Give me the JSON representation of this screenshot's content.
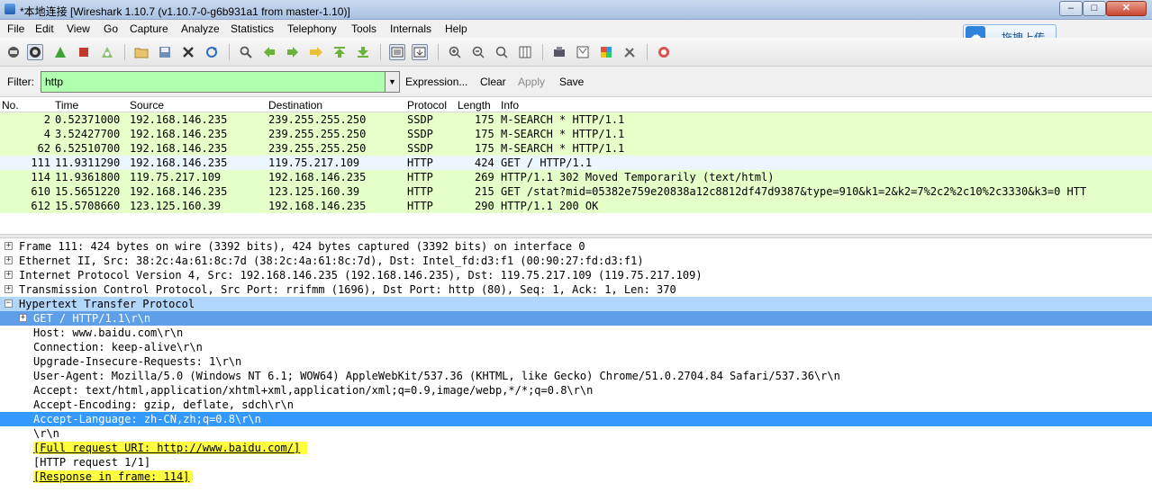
{
  "window": {
    "title": "*本地连接  [Wireshark 1.10.7  (v1.10.7-0-g6b931a1 from master-1.10)]",
    "buttons": {
      "minimize": "–",
      "maximize": "□",
      "close": "✕"
    }
  },
  "menu": [
    "File",
    "Edit",
    "View",
    "Go",
    "Capture",
    "Analyze",
    "Statistics",
    "Telephony",
    "Tools",
    "Internals",
    "Help"
  ],
  "cloud_upload": {
    "label": "拖拽上传"
  },
  "filter": {
    "label": "Filter:",
    "value": "http",
    "actions": {
      "expression": "Expression...",
      "clear": "Clear",
      "apply": "Apply",
      "save": "Save"
    }
  },
  "packet_list": {
    "columns": {
      "no": "No.",
      "time": "Time",
      "source": "Source",
      "destination": "Destination",
      "protocol": "Protocol",
      "length": "Length",
      "info": "Info"
    },
    "rows": [
      {
        "no": "2",
        "time": "0.52371000",
        "source": "192.168.146.235",
        "destination": "239.255.255.250",
        "protocol": "SSDP",
        "length": "175",
        "info": "M-SEARCH * HTTP/1.1"
      },
      {
        "no": "4",
        "time": "3.52427700",
        "source": "192.168.146.235",
        "destination": "239.255.255.250",
        "protocol": "SSDP",
        "length": "175",
        "info": "M-SEARCH * HTTP/1.1"
      },
      {
        "no": "62",
        "time": "6.52510700",
        "source": "192.168.146.235",
        "destination": "239.255.255.250",
        "protocol": "SSDP",
        "length": "175",
        "info": "M-SEARCH * HTTP/1.1"
      },
      {
        "no": "111",
        "time": "11.9311290",
        "source": "192.168.146.235",
        "destination": "119.75.217.109",
        "protocol": "HTTP",
        "length": "424",
        "info": "GET / HTTP/1.1"
      },
      {
        "no": "114",
        "time": "11.9361800",
        "source": "119.75.217.109",
        "destination": "192.168.146.235",
        "protocol": "HTTP",
        "length": "269",
        "info": "HTTP/1.1 302 Moved Temporarily  (text/html)"
      },
      {
        "no": "610",
        "time": "15.5651220",
        "source": "192.168.146.235",
        "destination": "123.125.160.39",
        "protocol": "HTTP",
        "length": "215",
        "info": "GET /stat?mid=05382e759e20838a12c8812df47d9387&type=910&k1=2&k2=7%2c2%2c10%2c3330&k3=0 HTT"
      },
      {
        "no": "612",
        "time": "15.5708660",
        "source": "123.125.160.39",
        "destination": "192.168.146.235",
        "protocol": "HTTP",
        "length": "290",
        "info": "HTTP/1.1 200 OK"
      }
    ]
  },
  "detail_tree": {
    "frame": "Frame 111: 424 bytes on wire (3392 bits), 424 bytes captured (3392 bits) on interface 0",
    "ethernet": "Ethernet II, Src: 38:2c:4a:61:8c:7d (38:2c:4a:61:8c:7d), Dst: Intel_fd:d3:f1 (00:90:27:fd:d3:f1)",
    "ip": "Internet Protocol Version 4, Src: 192.168.146.235 (192.168.146.235), Dst: 119.75.217.109 (119.75.217.109)",
    "tcp": "Transmission Control Protocol, Src Port: rrifmm (1696), Dst Port: http (80), Seq: 1, Ack: 1, Len: 370",
    "http": "Hypertext Transfer Protocol",
    "get": "GET / HTTP/1.1\\r\\n",
    "host": "Host: www.baidu.com\\r\\n",
    "connection": "Connection: keep-alive\\r\\n",
    "upgrade": "Upgrade-Insecure-Requests: 1\\r\\n",
    "user_agent": "User-Agent: Mozilla/5.0 (Windows NT 6.1; WOW64) AppleWebKit/537.36 (KHTML, like Gecko) Chrome/51.0.2704.84 Safari/537.36\\r\\n",
    "accept": "Accept: text/html,application/xhtml+xml,application/xml;q=0.9,image/webp,*/*;q=0.8\\r\\n",
    "accept_encoding": "Accept-Encoding: gzip, deflate, sdch\\r\\n",
    "accept_language": "Accept-Language: zh-CN,zh;q=0.8\\r\\n",
    "crlf": "\\r\\n",
    "full_uri": "[Full request URI: http://www.baidu.com/]",
    "http_request": "[HTTP request 1/1]",
    "response_in": "[Response in frame: 114]",
    "expand": "+",
    "collapse": "−"
  },
  "colors": {
    "filter_valid": "#afffaf",
    "row_ssdp": "#e7ffc8",
    "row_http": "#e4ffc7",
    "selection": "#3399ff",
    "highlight_marker": "#ffff40"
  }
}
